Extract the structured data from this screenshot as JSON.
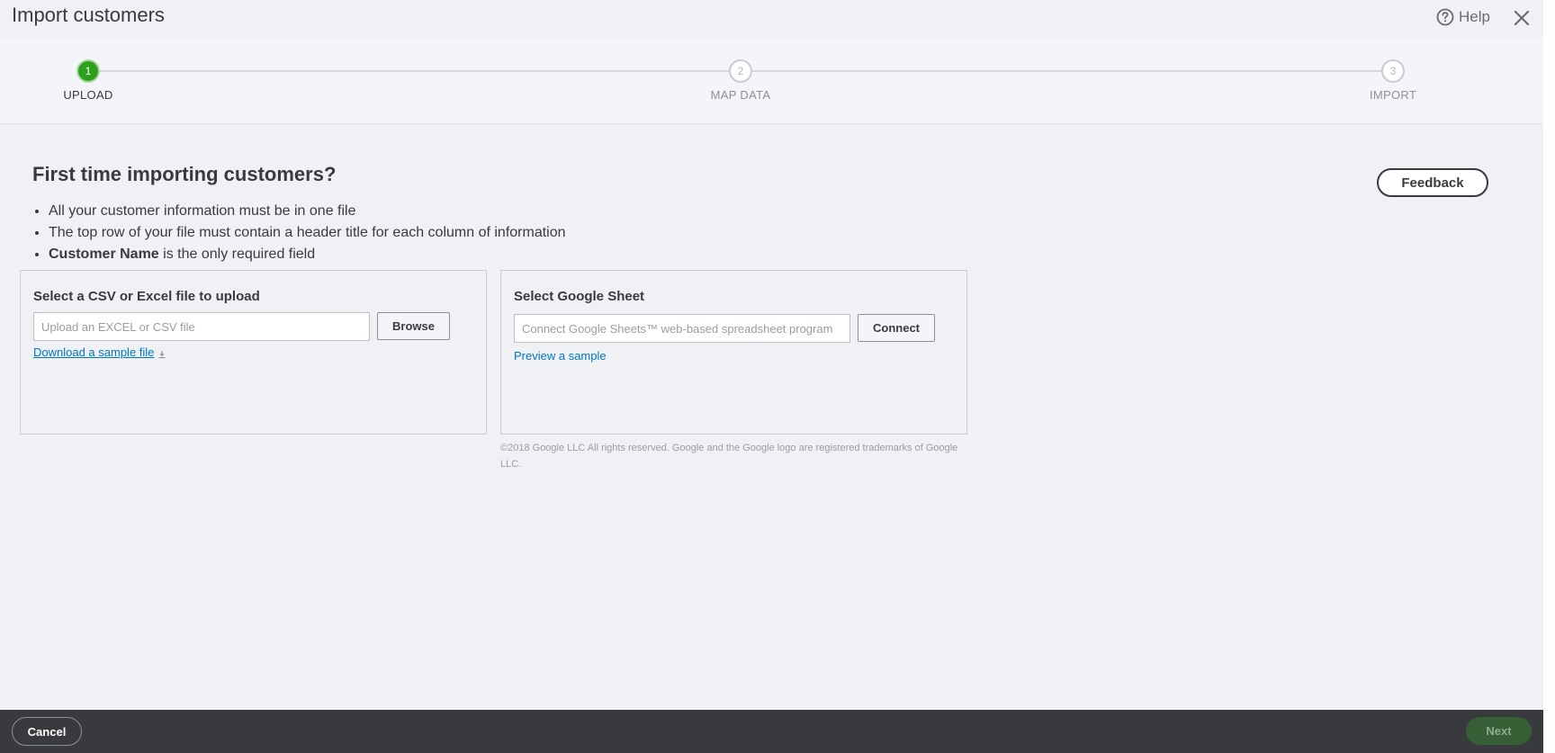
{
  "header": {
    "title": "Import customers",
    "help_label": "Help"
  },
  "stepper": {
    "steps": [
      {
        "number": "1",
        "label": "UPLOAD",
        "active": true
      },
      {
        "number": "2",
        "label": "MAP DATA",
        "active": false
      },
      {
        "number": "3",
        "label": "IMPORT",
        "active": false
      }
    ]
  },
  "main": {
    "heading": "First time importing customers?",
    "feedback_label": "Feedback",
    "requirements": [
      {
        "text": "All your customer information must be in one file"
      },
      {
        "text": "The top row of your file must contain a header title for each column of information"
      },
      {
        "bold": "Customer Name",
        "text": " is the only required field"
      }
    ]
  },
  "csv_card": {
    "title": "Select a CSV or Excel file to upload",
    "input_placeholder": "Upload an EXCEL or CSV file",
    "input_value": "",
    "browse_label": "Browse",
    "download_link": "Download a sample file"
  },
  "gsheet_card": {
    "title": "Select Google Sheet",
    "input_placeholder": "Connect Google Sheets™ web-based spreadsheet program",
    "input_value": "",
    "connect_label": "Connect",
    "preview_link": "Preview a sample",
    "legal": "©2018 Google LLC All rights reserved. Google and the Google logo are registered trademarks of Google LLC."
  },
  "footer": {
    "cancel_label": "Cancel",
    "next_label": "Next"
  },
  "colors": {
    "accent_green": "#2ca01c",
    "link_blue": "#0077c5",
    "footer_bg": "#393a3d",
    "next_disabled": "#365f36"
  },
  "icons": {
    "help": "question-circle-icon",
    "close": "close-icon",
    "download": "download-icon"
  }
}
